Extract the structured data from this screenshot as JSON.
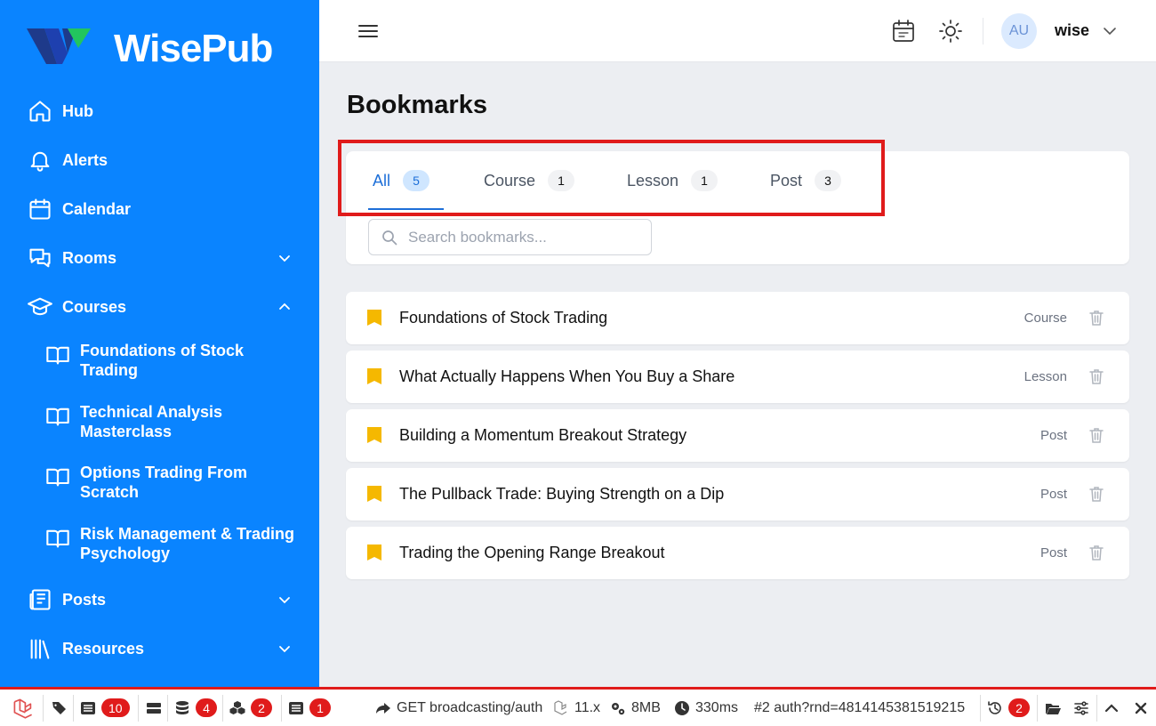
{
  "app": {
    "brand": "WisePub",
    "colors": {
      "sidebar": "#0a84ff",
      "accent": "#1d6fd8",
      "bookmark": "#f5b800",
      "highlight": "#e01b1b"
    }
  },
  "sidebar": {
    "items": [
      {
        "label": "Hub",
        "icon": "home-icon"
      },
      {
        "label": "Alerts",
        "icon": "bell-icon"
      },
      {
        "label": "Calendar",
        "icon": "calendar-icon"
      },
      {
        "label": "Rooms",
        "icon": "chat-icon",
        "expanded": false
      },
      {
        "label": "Courses",
        "icon": "graduation-cap-icon",
        "expanded": true
      },
      {
        "label": "Posts",
        "icon": "newspaper-icon",
        "expanded": false
      },
      {
        "label": "Resources",
        "icon": "library-icon",
        "expanded": false
      }
    ],
    "courses": [
      {
        "label": "Foundations of Stock Trading"
      },
      {
        "label": "Technical Analysis Masterclass"
      },
      {
        "label": "Options Trading From Scratch"
      },
      {
        "label": "Risk Management & Trading Psychology"
      }
    ]
  },
  "header": {
    "avatar_initials": "AU",
    "user_name": "wise"
  },
  "main": {
    "title": "Bookmarks",
    "tabs": [
      {
        "label": "All",
        "count": "5",
        "active": true
      },
      {
        "label": "Course",
        "count": "1"
      },
      {
        "label": "Lesson",
        "count": "1"
      },
      {
        "label": "Post",
        "count": "3"
      }
    ],
    "search_placeholder": "Search bookmarks...",
    "bookmarks": [
      {
        "title": "Foundations of Stock Trading",
        "type": "Course"
      },
      {
        "title": "What Actually Happens When You Buy a Share",
        "type": "Lesson"
      },
      {
        "title": "Building a Momentum Breakout Strategy",
        "type": "Post"
      },
      {
        "title": "The Pullback Trade: Buying Strength on a Dip",
        "type": "Post"
      },
      {
        "title": "Trading the Opening Range Breakout",
        "type": "Post"
      }
    ]
  },
  "debugbar": {
    "messages_count": "10",
    "queries_count": "4",
    "models_count": "2",
    "views_count": "1",
    "request": "GET broadcasting/auth",
    "version": "11.x",
    "memory": "8MB",
    "time": "330ms",
    "request_id": "#2 auth?rnd=4814145381519215",
    "history_count": "2"
  }
}
